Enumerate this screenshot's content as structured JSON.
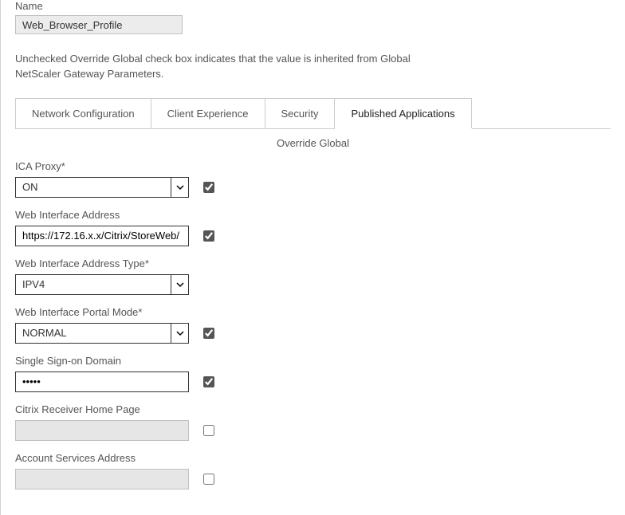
{
  "header": {
    "name_label": "Name",
    "name_value": "Web_Browser_Profile",
    "helper_text": "Unchecked Override Global check box indicates that the value is inherited from Global NetScaler Gateway Parameters."
  },
  "tabs": {
    "network": "Network Configuration",
    "client": "Client Experience",
    "security": "Security",
    "published": "Published Applications"
  },
  "panel": {
    "heading": "Override Global"
  },
  "fields": {
    "ica_proxy": {
      "label": "ICA Proxy*",
      "value": "ON",
      "override": true
    },
    "wi_address": {
      "label": "Web Interface Address",
      "value": "https://172.16.x.x/Citrix/StoreWeb/",
      "override": true
    },
    "wi_addr_type": {
      "label": "Web Interface Address Type*",
      "value": "IPV4",
      "override": false
    },
    "wi_portal_mode": {
      "label": "Web Interface Portal Mode*",
      "value": "NORMAL",
      "override": true
    },
    "sso_domain": {
      "label": "Single Sign-on Domain",
      "value": "•••••",
      "override": true
    },
    "receiver_home": {
      "label": "Citrix Receiver Home Page",
      "value": "",
      "override": false
    },
    "acct_services": {
      "label": "Account Services Address",
      "value": "",
      "override": false
    }
  }
}
